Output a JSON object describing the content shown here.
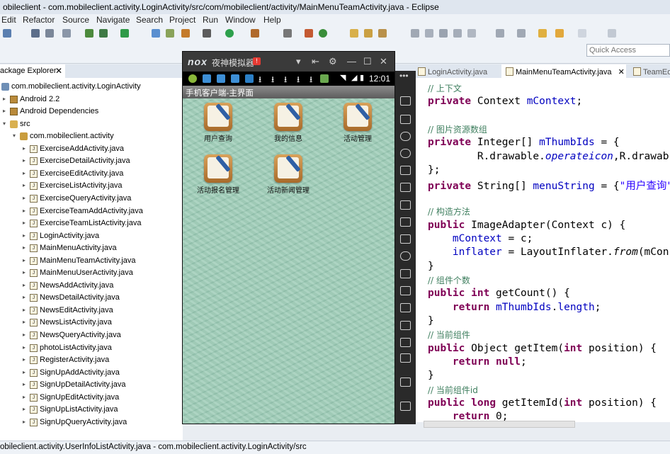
{
  "window": {
    "title": "obileclient - com.mobileclient.activity.LoginActivity/src/com/mobileclient/activity/MainMenuTeamActivity.java - Eclipse"
  },
  "menu": [
    "Edit",
    "Refactor",
    "Source",
    "Navigate",
    "Search",
    "Project",
    "Run",
    "Window",
    "Help"
  ],
  "toolbar": {
    "quick_access_placeholder": "Quick Access"
  },
  "package_explorer": {
    "tab_label": "ackage Explorer",
    "items": [
      {
        "label": "com.mobileclient.activity.LoginActivity",
        "kind": "project",
        "arrow": "▾",
        "level": 0
      },
      {
        "label": "Android 2.2",
        "kind": "library",
        "arrow": "▸",
        "level": 1
      },
      {
        "label": "Android Dependencies",
        "kind": "library",
        "arrow": "▸",
        "level": 1
      },
      {
        "label": "src",
        "kind": "source-folder",
        "arrow": "▾",
        "level": 1
      },
      {
        "label": "com.mobileclient.activity",
        "kind": "package",
        "arrow": "▾",
        "level": 2
      },
      {
        "label": "ExerciseAddActivity.java",
        "kind": "java",
        "arrow": "▸",
        "level": 3
      },
      {
        "label": "ExerciseDetailActivity.java",
        "kind": "java",
        "arrow": "▸",
        "level": 3
      },
      {
        "label": "ExerciseEditActivity.java",
        "kind": "java",
        "arrow": "▸",
        "level": 3
      },
      {
        "label": "ExerciseListActivity.java",
        "kind": "java",
        "arrow": "▸",
        "level": 3
      },
      {
        "label": "ExerciseQueryActivity.java",
        "kind": "java",
        "arrow": "▸",
        "level": 3
      },
      {
        "label": "ExerciseTeamAddActivity.java",
        "kind": "java",
        "arrow": "▸",
        "level": 3
      },
      {
        "label": "ExerciseTeamListActivity.java",
        "kind": "java",
        "arrow": "▸",
        "level": 3
      },
      {
        "label": "LoginActivity.java",
        "kind": "java",
        "arrow": "▸",
        "level": 3
      },
      {
        "label": "MainMenuActivity.java",
        "kind": "java",
        "arrow": "▸",
        "level": 3
      },
      {
        "label": "MainMenuTeamActivity.java",
        "kind": "java",
        "arrow": "▸",
        "level": 3
      },
      {
        "label": "MainMenuUserActivity.java",
        "kind": "java",
        "arrow": "▸",
        "level": 3
      },
      {
        "label": "NewsAddActivity.java",
        "kind": "java",
        "arrow": "▸",
        "level": 3
      },
      {
        "label": "NewsDetailActivity.java",
        "kind": "java",
        "arrow": "▸",
        "level": 3
      },
      {
        "label": "NewsEditActivity.java",
        "kind": "java",
        "arrow": "▸",
        "level": 3
      },
      {
        "label": "NewsListActivity.java",
        "kind": "java",
        "arrow": "▸",
        "level": 3
      },
      {
        "label": "NewsQueryActivity.java",
        "kind": "java",
        "arrow": "▸",
        "level": 3
      },
      {
        "label": "photoListActivity.java",
        "kind": "java",
        "arrow": "▸",
        "level": 3
      },
      {
        "label": "RegisterActivity.java",
        "kind": "java",
        "arrow": "▸",
        "level": 3
      },
      {
        "label": "SignUpAddActivity.java",
        "kind": "java",
        "arrow": "▸",
        "level": 3
      },
      {
        "label": "SignUpDetailActivity.java",
        "kind": "java",
        "arrow": "▸",
        "level": 3
      },
      {
        "label": "SignUpEditActivity.java",
        "kind": "java",
        "arrow": "▸",
        "level": 3
      },
      {
        "label": "SignUpListActivity.java",
        "kind": "java",
        "arrow": "▸",
        "level": 3
      },
      {
        "label": "SignUpQueryActivity.java",
        "kind": "java",
        "arrow": "▸",
        "level": 3
      }
    ]
  },
  "editor": {
    "tabs": [
      {
        "label": "LoginActivity.java",
        "active": false
      },
      {
        "label": "MainMenuTeamActivity.java",
        "active": true
      },
      {
        "label": "TeamEd",
        "active": false
      }
    ],
    "lines": [
      [
        {
          "t": "// 上下文",
          "c": "cm"
        }
      ],
      [
        {
          "t": "private",
          "c": "kw"
        },
        {
          "t": " Context ",
          "c": ""
        },
        {
          "t": "mContext",
          "c": "fld"
        },
        {
          "t": ";",
          "c": ""
        }
      ],
      [],
      [
        {
          "t": "// 图片资源数组",
          "c": "cm"
        }
      ],
      [
        {
          "t": "private",
          "c": "kw"
        },
        {
          "t": " Integer[] ",
          "c": ""
        },
        {
          "t": "mThumbIds",
          "c": "fld"
        },
        {
          "t": " = {",
          "c": ""
        }
      ],
      [
        {
          "t": "        R.drawable.",
          "c": ""
        },
        {
          "t": "operateicon",
          "c": "fld it"
        },
        {
          "t": ",R.drawab",
          "c": ""
        }
      ],
      [
        {
          "t": "};",
          "c": ""
        }
      ],
      [
        {
          "t": "private",
          "c": "kw"
        },
        {
          "t": " String[] ",
          "c": ""
        },
        {
          "t": "menuString",
          "c": "fld"
        },
        {
          "t": " = {",
          "c": ""
        },
        {
          "t": "\"用户查询\"",
          "c": "strg"
        }
      ],
      [],
      [
        {
          "t": "// 构造方法",
          "c": "cm"
        }
      ],
      [
        {
          "t": "public",
          "c": "kw"
        },
        {
          "t": " ImageAdapter(Context c) {",
          "c": ""
        }
      ],
      [
        {
          "t": "    ",
          "c": ""
        },
        {
          "t": "mContext",
          "c": "fld"
        },
        {
          "t": " = c;",
          "c": ""
        }
      ],
      [
        {
          "t": "    ",
          "c": ""
        },
        {
          "t": "inflater",
          "c": "fld"
        },
        {
          "t": " = LayoutInflater.",
          "c": ""
        },
        {
          "t": "from",
          "c": "it"
        },
        {
          "t": "(mCon",
          "c": ""
        }
      ],
      [
        {
          "t": "}",
          "c": ""
        }
      ],
      [
        {
          "t": "// 组件个数",
          "c": "cm"
        }
      ],
      [
        {
          "t": "public",
          "c": "kw"
        },
        {
          "t": " ",
          "c": ""
        },
        {
          "t": "int",
          "c": "kw"
        },
        {
          "t": " getCount() {",
          "c": ""
        }
      ],
      [
        {
          "t": "    ",
          "c": ""
        },
        {
          "t": "return",
          "c": "kw"
        },
        {
          "t": " ",
          "c": ""
        },
        {
          "t": "mThumbIds",
          "c": "fld"
        },
        {
          "t": ".",
          "c": ""
        },
        {
          "t": "length",
          "c": "fld"
        },
        {
          "t": ";",
          "c": ""
        }
      ],
      [
        {
          "t": "}",
          "c": ""
        }
      ],
      [
        {
          "t": "// 当前组件",
          "c": "cm"
        }
      ],
      [
        {
          "t": "public",
          "c": "kw"
        },
        {
          "t": " Object getItem(",
          "c": ""
        },
        {
          "t": "int",
          "c": "kw"
        },
        {
          "t": " position) {",
          "c": ""
        }
      ],
      [
        {
          "t": "    ",
          "c": ""
        },
        {
          "t": "return",
          "c": "kw"
        },
        {
          "t": " ",
          "c": ""
        },
        {
          "t": "null",
          "c": "kw"
        },
        {
          "t": ";",
          "c": ""
        }
      ],
      [
        {
          "t": "}",
          "c": ""
        }
      ],
      [
        {
          "t": "// 当前组件id",
          "c": "cm"
        }
      ],
      [
        {
          "t": "public",
          "c": "kw"
        },
        {
          "t": " ",
          "c": ""
        },
        {
          "t": "long",
          "c": "kw"
        },
        {
          "t": " getItemId(",
          "c": ""
        },
        {
          "t": "int",
          "c": "kw"
        },
        {
          "t": " position) {",
          "c": ""
        }
      ],
      [
        {
          "t": "    ",
          "c": ""
        },
        {
          "t": "return",
          "c": "kw"
        },
        {
          "t": " 0;",
          "c": ""
        }
      ]
    ]
  },
  "emulator": {
    "brand": "nox",
    "name": "夜神模拟器",
    "badge": "!",
    "controls": [
      "▾",
      "⇤",
      "⚙",
      "—",
      "☐",
      "✕"
    ],
    "clock": "12:01",
    "app_title": "手机客户端-主界面",
    "apps": [
      {
        "label": "用户查询"
      },
      {
        "label": "我的信息"
      },
      {
        "label": "活动管理"
      },
      {
        "label": "活动报名管理"
      },
      {
        "label": "活动新闻管理"
      }
    ]
  },
  "status_bar": {
    "text": "obileclient.activity.UserInfoListActivity.java - com.mobileclient.activity.LoginActivity/src"
  },
  "colors": {
    "accent_green_screen": "#9fcdb8",
    "comment": "#3f7f5f",
    "keyword": "#7f0055",
    "field": "#0000c0",
    "string": "#2a00ff"
  }
}
